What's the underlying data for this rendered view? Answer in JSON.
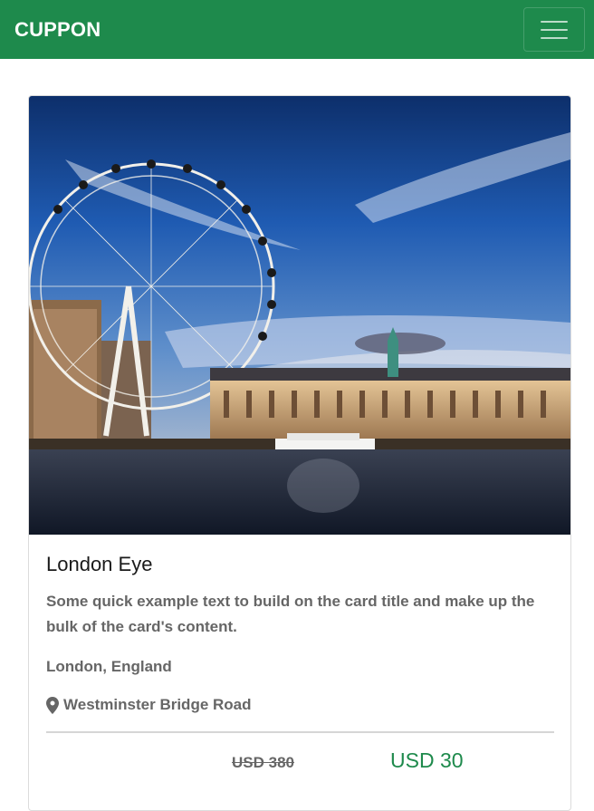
{
  "navbar": {
    "brand": "CUPPON",
    "menu_icon": "hamburger-menu-icon"
  },
  "card": {
    "image_alt": "London Eye",
    "title": "London Eye",
    "text": "Some quick example text to build on the card title and make up the bulk of the card's content.",
    "location": "London, England",
    "address_icon": "map-marker-icon",
    "address": "Westminster Bridge Road",
    "old_price": "USD 380",
    "new_price": "USD 30"
  },
  "colors": {
    "brand_green": "#1e8a4c",
    "text_gray": "#666666"
  }
}
